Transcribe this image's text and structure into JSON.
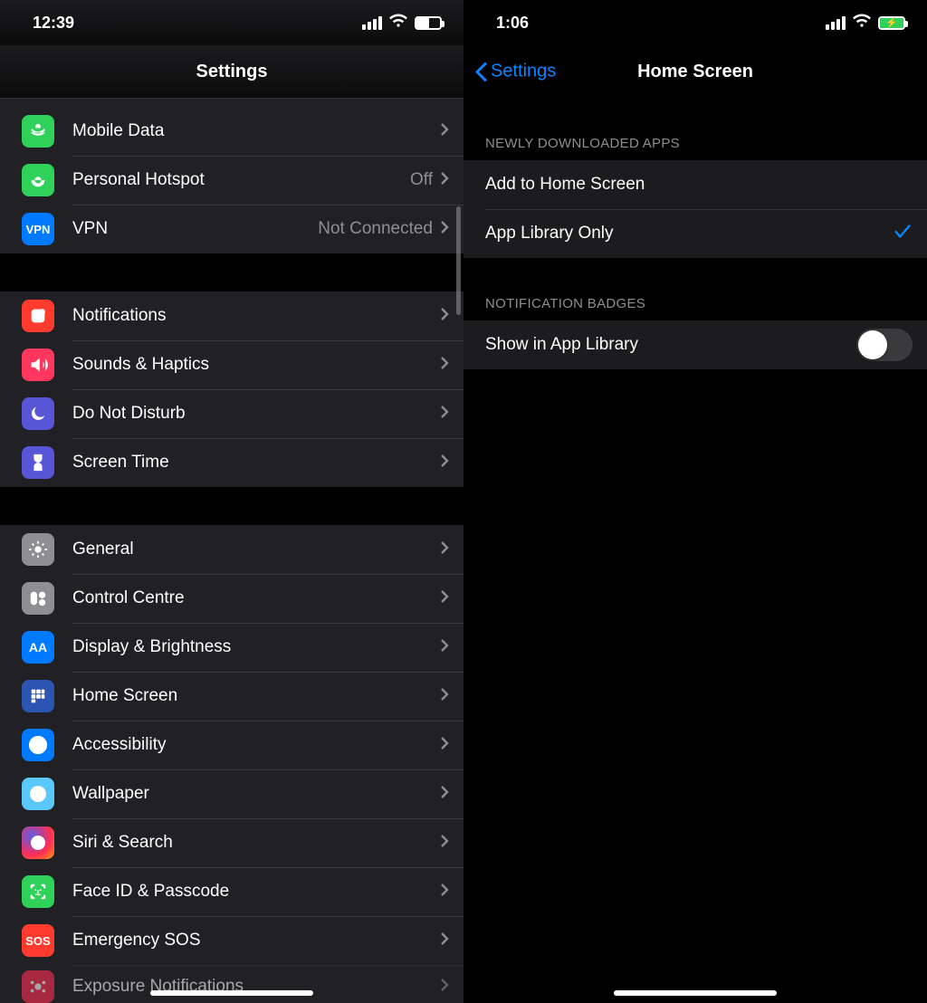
{
  "left": {
    "status_time": "12:39",
    "nav_title": "Settings",
    "groups": [
      {
        "rows": [
          {
            "label": "Mobile Data",
            "value": "",
            "icon": "mobile-data",
            "color": "bg-green"
          },
          {
            "label": "Personal Hotspot",
            "value": "Off",
            "icon": "hotspot",
            "color": "bg-green"
          },
          {
            "label": "VPN",
            "value": "Not Connected",
            "icon": "vpn",
            "color": "bg-blue"
          }
        ]
      },
      {
        "rows": [
          {
            "label": "Notifications",
            "value": "",
            "icon": "notifications",
            "color": "bg-red"
          },
          {
            "label": "Sounds & Haptics",
            "value": "",
            "icon": "sounds",
            "color": "bg-pink"
          },
          {
            "label": "Do Not Disturb",
            "value": "",
            "icon": "dnd",
            "color": "bg-indigo"
          },
          {
            "label": "Screen Time",
            "value": "",
            "icon": "screentime",
            "color": "bg-indigo"
          }
        ]
      },
      {
        "rows": [
          {
            "label": "General",
            "value": "",
            "icon": "general",
            "color": "bg-gray"
          },
          {
            "label": "Control Centre",
            "value": "",
            "icon": "controlcentre",
            "color": "bg-gray"
          },
          {
            "label": "Display & Brightness",
            "value": "",
            "icon": "display",
            "color": "bg-blue"
          },
          {
            "label": "Home Screen",
            "value": "",
            "icon": "homescreen",
            "color": "bg-darkblue"
          },
          {
            "label": "Accessibility",
            "value": "",
            "icon": "accessibility",
            "color": "bg-blue"
          },
          {
            "label": "Wallpaper",
            "value": "",
            "icon": "wallpaper",
            "color": "bg-cyan"
          },
          {
            "label": "Siri & Search",
            "value": "",
            "icon": "siri",
            "color": "bg-siri"
          },
          {
            "label": "Face ID & Passcode",
            "value": "",
            "icon": "faceid",
            "color": "bg-green"
          },
          {
            "label": "Emergency SOS",
            "value": "",
            "icon": "sos",
            "color": "bg-red"
          },
          {
            "label": "Exposure Notifications",
            "value": "",
            "icon": "exposure",
            "color": "bg-rose"
          }
        ]
      }
    ]
  },
  "right": {
    "status_time": "1:06",
    "nav_back": "Settings",
    "nav_title": "Home Screen",
    "section1_header": "Newly Downloaded Apps",
    "section1_rows": [
      {
        "label": "Add to Home Screen",
        "selected": false
      },
      {
        "label": "App Library Only",
        "selected": true
      }
    ],
    "section2_header": "Notification Badges",
    "section2_row": {
      "label": "Show in App Library",
      "toggle_on": false
    }
  }
}
